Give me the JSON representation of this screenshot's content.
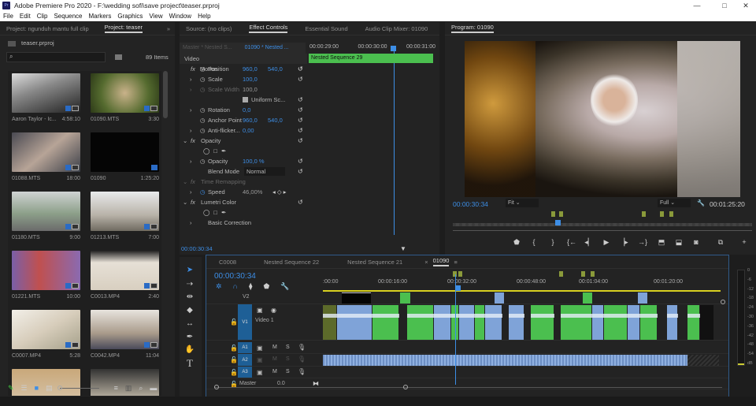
{
  "app": {
    "title": "Adobe Premiere Pro 2020 - F:\\wedding sofi\\save project\\teaser.prproj",
    "logo": "Pr"
  },
  "menu": [
    "File",
    "Edit",
    "Clip",
    "Sequence",
    "Markers",
    "Graphics",
    "View",
    "Window",
    "Help"
  ],
  "project": {
    "tabs": [
      "Project: ngunduh mantu full clip",
      "Project: teaser"
    ],
    "file": "teaser.prproj",
    "search_placeholder": "",
    "items_count": "89 Items",
    "items": [
      {
        "name": "Aaron Taylor - Ic...",
        "dur": "4:58:10"
      },
      {
        "name": "01090.MTS",
        "dur": "3:30"
      },
      {
        "name": "01088.MTS",
        "dur": "18:00"
      },
      {
        "name": "01090",
        "dur": "1:25:20"
      },
      {
        "name": "01180.MTS",
        "dur": "9:00"
      },
      {
        "name": "01213.MTS",
        "dur": "7:00"
      },
      {
        "name": "01221.MTS",
        "dur": "10:00"
      },
      {
        "name": "C0013.MP4",
        "dur": "2:40"
      },
      {
        "name": "C0007.MP4",
        "dur": "5:28"
      },
      {
        "name": "C0042.MP4",
        "dur": "11:04"
      }
    ]
  },
  "effects": {
    "tabs": [
      "Source: (no clips)",
      "Effect Controls",
      "Essential Sound",
      "Audio Clip Mixer: 01090"
    ],
    "master": "Master * Nested S...",
    "clip": "01090 * Nested ...",
    "ruler": [
      "00:00:29:00",
      "00:00:30:00",
      "00:00:31:00"
    ],
    "clip_bar": "Nested Sequence 29",
    "section": "Video",
    "motion": "Motion",
    "position_label": "Position",
    "position_x": "960,0",
    "position_y": "540,0",
    "scale_label": "Scale",
    "scale": "100,0",
    "scale_width_label": "Scale Width",
    "scale_width": "100,0",
    "uniform": "Uniform Sc...",
    "rotation_label": "Rotation",
    "rotation": "0,0",
    "anchor_label": "Anchor Point",
    "anchor_x": "960,0",
    "anchor_y": "540,0",
    "flicker_label": "Anti-flicker...",
    "flicker": "0,00",
    "opacity_section": "Opacity",
    "opacity_label": "Opacity",
    "opacity": "100,0 %",
    "blend_label": "Blend Mode",
    "blend": "Normal",
    "time_remap": "Time Remapping",
    "speed_label": "Speed",
    "speed": "46,00%",
    "lumetri": "Lumetri Color",
    "basic": "Basic Correction",
    "timecode": "00:00:30:34"
  },
  "program": {
    "tab": "Program: 01090",
    "timecode": "00:00:30:34",
    "fit": "Fit",
    "quality": "Full",
    "duration": "00:01:25:20"
  },
  "timeline": {
    "tabs": [
      "C0008",
      "Nested Sequence 22",
      "Nested Sequence 21",
      "01090"
    ],
    "timecode": "00:00:30:34",
    "ruler": [
      ":00:00",
      "00:00:16:00",
      "00:00:32:00",
      "00:00:48:00",
      "00:01:04:00",
      "00:01:20:00"
    ],
    "tracks": {
      "v2": "V2",
      "v1": "V1",
      "v1_name": "Video 1",
      "a1": "A1",
      "a2": "A2",
      "a3": "A3",
      "master": "Master",
      "master_val": "0.0",
      "m": "M",
      "s": "S"
    }
  },
  "meter": [
    "0",
    "-6",
    "-12",
    "-18",
    "-24",
    "-30",
    "-36",
    "-42",
    "-48",
    "-54",
    "dB"
  ]
}
